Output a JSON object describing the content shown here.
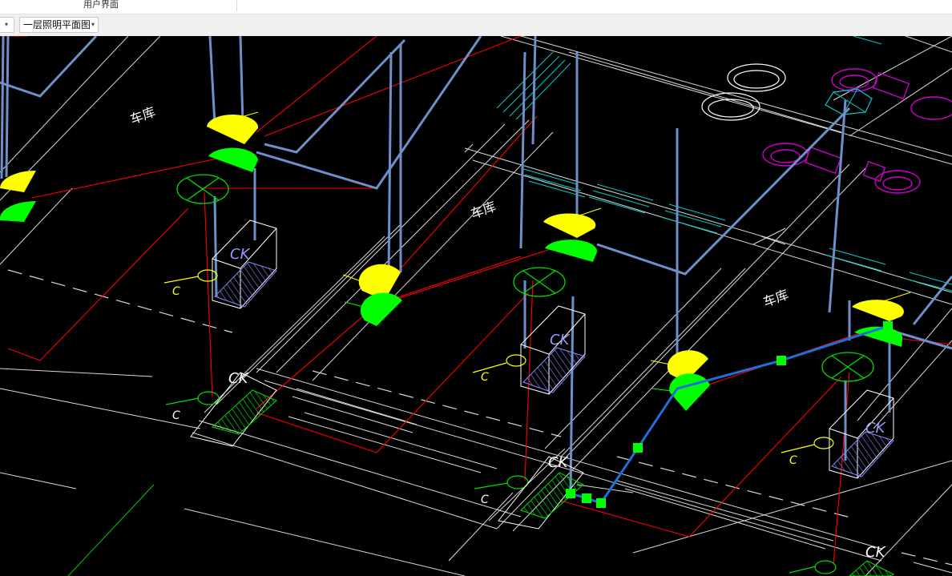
{
  "ribbon": {
    "group_label": "用户界面"
  },
  "toolbar": {
    "layout_combo": "一层照明平面图",
    "dropdown_arrow": "▾"
  },
  "drawing": {
    "room_labels": [
      "车库",
      "车库",
      "车库"
    ],
    "switch_label": "C",
    "box_label": "CK",
    "panel_label": "CK"
  },
  "colors": {
    "background": "#000000",
    "wall_line": "#ffffff",
    "cable_red": "#ff0000",
    "conduit_blue": "#6f8fc9",
    "lamp_yellow": "#ffff00",
    "lamp_green": "#00ff00",
    "fixture_magenta": "#cc00cc",
    "hatch_cyan": "#00cccc",
    "box_blue": "#8888ff",
    "grip_green": "#00ff00",
    "selected_blue": "#1e6fd9"
  }
}
